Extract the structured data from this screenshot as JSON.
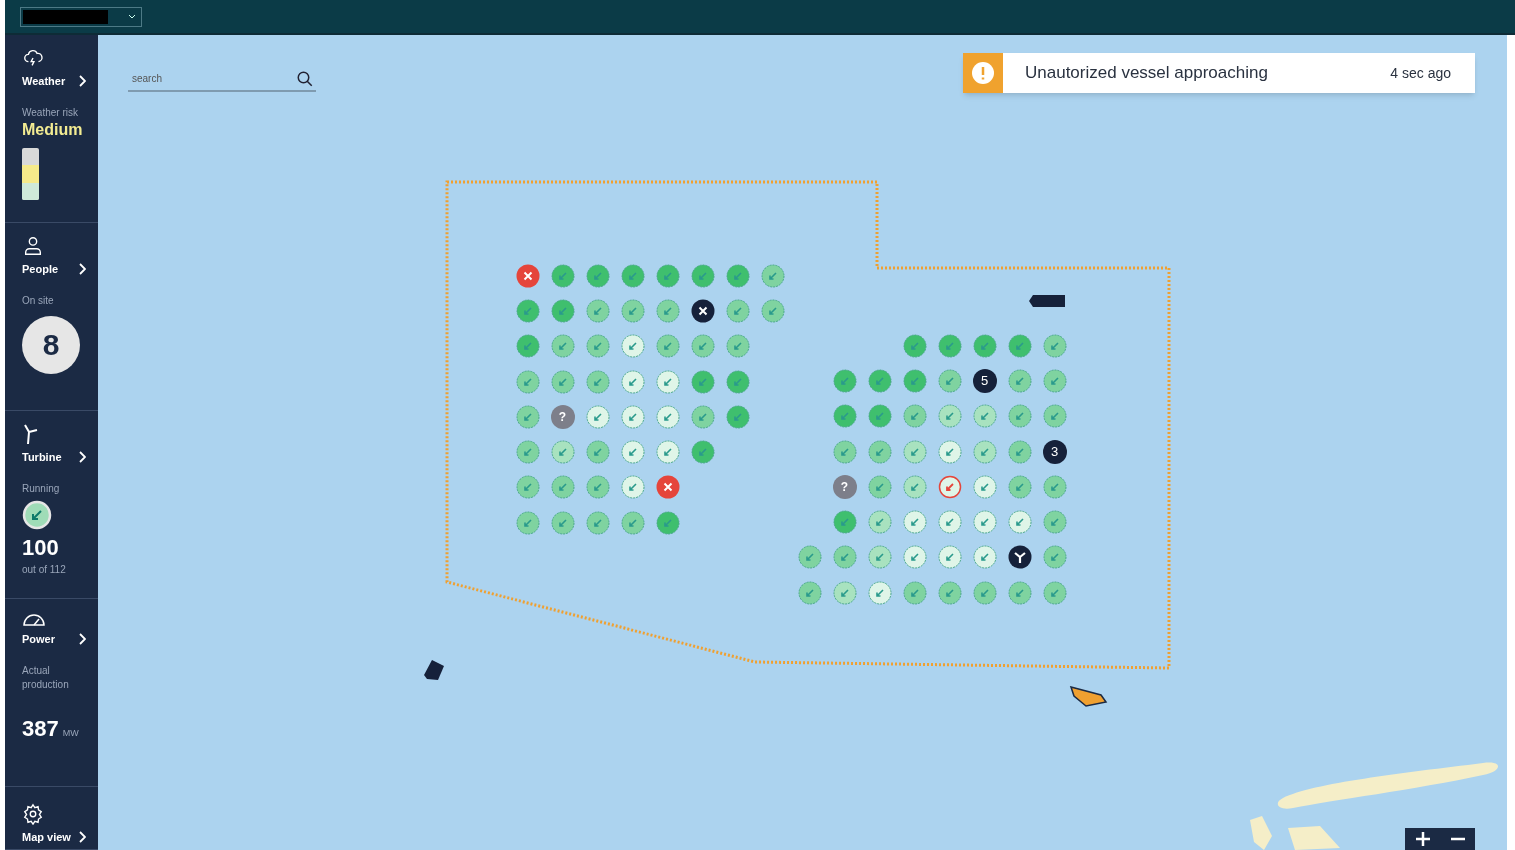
{
  "search": {
    "placeholder": "search"
  },
  "alert": {
    "message": "Unautorized vessel approaching",
    "time": "4 sec ago"
  },
  "sidebar": {
    "sections": [
      {
        "kind": "weather",
        "title": "Weather",
        "label": "Weather risk",
        "value": "Medium",
        "level": 0.67
      },
      {
        "kind": "people",
        "title": "People",
        "label": "On site",
        "value": "8"
      },
      {
        "kind": "turbine",
        "title": "Turbine",
        "label": "Running",
        "value": "100",
        "note": "out of 112"
      },
      {
        "kind": "power",
        "title": "Power",
        "label": "Actual production",
        "value": "387",
        "unit": "MW"
      },
      {
        "kind": "settings",
        "title": "Map view"
      }
    ]
  },
  "clusters": [
    {
      "rows": [
        [
          {
            "kind": "fault"
          },
          {
            "kind": "running",
            "color": "#3fbf6e"
          },
          {
            "kind": "running",
            "color": "#3fbf6e"
          },
          {
            "kind": "running",
            "color": "#3fbf6e"
          },
          {
            "kind": "running",
            "color": "#3fbf6e"
          },
          {
            "kind": "running",
            "color": "#3fbf6e"
          },
          {
            "kind": "running",
            "color": "#3fbf6e"
          },
          {
            "kind": "running",
            "color": "#7fd3a0"
          }
        ],
        [
          {
            "kind": "running",
            "color": "#3fbf6e"
          },
          {
            "kind": "running",
            "color": "#3fbf6e"
          },
          {
            "kind": "running",
            "color": "#7fd3a0"
          },
          {
            "kind": "running",
            "color": "#7fd3a0"
          },
          {
            "kind": "running",
            "color": "#7fd3a0"
          },
          {
            "kind": "stopped"
          },
          {
            "kind": "running",
            "color": "#7fd3a0"
          },
          {
            "kind": "running",
            "color": "#7fd3a0"
          }
        ],
        [
          {
            "kind": "running",
            "color": "#3fbf6e"
          },
          {
            "kind": "running",
            "color": "#7fd3a0"
          },
          {
            "kind": "running",
            "color": "#7fd3a0"
          },
          {
            "kind": "running",
            "color": "#dff5e8"
          },
          {
            "kind": "running",
            "color": "#7fd3a0"
          },
          {
            "kind": "running",
            "color": "#7fd3a0"
          },
          {
            "kind": "running",
            "color": "#7fd3a0"
          }
        ],
        [
          {
            "kind": "running",
            "color": "#7fd3a0"
          },
          {
            "kind": "running",
            "color": "#7fd3a0"
          },
          {
            "kind": "running",
            "color": "#7fd3a0"
          },
          {
            "kind": "running",
            "color": "#dff5e8"
          },
          {
            "kind": "running",
            "color": "#dff5e8"
          },
          {
            "kind": "running",
            "color": "#3fbf6e"
          },
          {
            "kind": "running",
            "color": "#3fbf6e"
          }
        ],
        [
          {
            "kind": "running",
            "color": "#7fd3a0"
          },
          {
            "kind": "unknown",
            "label": "?"
          },
          {
            "kind": "running",
            "color": "#dff5e8"
          },
          {
            "kind": "running",
            "color": "#dff5e8"
          },
          {
            "kind": "running",
            "color": "#dff5e8"
          },
          {
            "kind": "running",
            "color": "#7fd3a0"
          },
          {
            "kind": "running",
            "color": "#3fbf6e"
          }
        ],
        [
          {
            "kind": "running",
            "color": "#7fd3a0"
          },
          {
            "kind": "running",
            "color": "#a8e2bf"
          },
          {
            "kind": "running",
            "color": "#7fd3a0"
          },
          {
            "kind": "running",
            "color": "#dff5e8"
          },
          {
            "kind": "running",
            "color": "#dff5e8"
          },
          {
            "kind": "running",
            "color": "#3fbf6e"
          }
        ],
        [
          {
            "kind": "running",
            "color": "#7fd3a0"
          },
          {
            "kind": "running",
            "color": "#7fd3a0"
          },
          {
            "kind": "running",
            "color": "#7fd3a0"
          },
          {
            "kind": "running",
            "color": "#dff5e8"
          },
          {
            "kind": "fault"
          }
        ],
        [
          {
            "kind": "running",
            "color": "#7fd3a0"
          },
          {
            "kind": "running",
            "color": "#7fd3a0"
          },
          {
            "kind": "running",
            "color": "#7fd3a0"
          },
          {
            "kind": "running",
            "color": "#7fd3a0"
          },
          {
            "kind": "running",
            "color": "#3fbf6e"
          }
        ]
      ]
    },
    {
      "rows": [
        [
          {
            "kind": "empty"
          },
          {
            "kind": "empty"
          },
          {
            "kind": "empty"
          },
          {
            "kind": "running",
            "color": "#3fbf6e"
          },
          {
            "kind": "running",
            "color": "#3fbf6e"
          },
          {
            "kind": "running",
            "color": "#3fbf6e"
          },
          {
            "kind": "running",
            "color": "#3fbf6e"
          },
          {
            "kind": "running",
            "color": "#7fd3a0"
          }
        ],
        [
          {
            "kind": "empty"
          },
          {
            "kind": "running",
            "color": "#3fbf6e"
          },
          {
            "kind": "running",
            "color": "#3fbf6e"
          },
          {
            "kind": "running",
            "color": "#3fbf6e"
          },
          {
            "kind": "running",
            "color": "#7fd3a0"
          },
          {
            "kind": "count",
            "label": "5"
          },
          {
            "kind": "running",
            "color": "#7fd3a0"
          },
          {
            "kind": "running",
            "color": "#7fd3a0"
          }
        ],
        [
          {
            "kind": "empty"
          },
          {
            "kind": "running",
            "color": "#3fbf6e"
          },
          {
            "kind": "running",
            "color": "#3fbf6e"
          },
          {
            "kind": "running",
            "color": "#7fd3a0"
          },
          {
            "kind": "running",
            "color": "#a8e2bf"
          },
          {
            "kind": "running",
            "color": "#a8e2bf"
          },
          {
            "kind": "running",
            "color": "#7fd3a0"
          },
          {
            "kind": "running",
            "color": "#7fd3a0"
          }
        ],
        [
          {
            "kind": "empty"
          },
          {
            "kind": "running",
            "color": "#7fd3a0"
          },
          {
            "kind": "running",
            "color": "#7fd3a0"
          },
          {
            "kind": "running",
            "color": "#a8e2bf"
          },
          {
            "kind": "running",
            "color": "#dff5e8"
          },
          {
            "kind": "running",
            "color": "#a8e2bf"
          },
          {
            "kind": "running",
            "color": "#7fd3a0"
          },
          {
            "kind": "count",
            "label": "3"
          }
        ],
        [
          {
            "kind": "empty"
          },
          {
            "kind": "unknown",
            "label": "?"
          },
          {
            "kind": "running",
            "color": "#7fd3a0"
          },
          {
            "kind": "running",
            "color": "#a8e2bf"
          },
          {
            "kind": "alert"
          },
          {
            "kind": "running",
            "color": "#dff5e8"
          },
          {
            "kind": "running",
            "color": "#7fd3a0"
          },
          {
            "kind": "running",
            "color": "#7fd3a0"
          }
        ],
        [
          {
            "kind": "empty"
          },
          {
            "kind": "running",
            "color": "#3fbf6e"
          },
          {
            "kind": "running",
            "color": "#a8e2bf"
          },
          {
            "kind": "running",
            "color": "#dff5e8"
          },
          {
            "kind": "running",
            "color": "#dff5e8"
          },
          {
            "kind": "running",
            "color": "#dff5e8"
          },
          {
            "kind": "running",
            "color": "#dff5e8"
          },
          {
            "kind": "running",
            "color": "#7fd3a0"
          }
        ],
        [
          {
            "kind": "running",
            "color": "#7fd3a0"
          },
          {
            "kind": "running",
            "color": "#7fd3a0"
          },
          {
            "kind": "running",
            "color": "#a8e2bf"
          },
          {
            "kind": "running",
            "color": "#dff5e8"
          },
          {
            "kind": "running",
            "color": "#dff5e8"
          },
          {
            "kind": "running",
            "color": "#dff5e8"
          },
          {
            "kind": "maintenance"
          },
          {
            "kind": "running",
            "color": "#7fd3a0"
          }
        ],
        [
          {
            "kind": "running",
            "color": "#7fd3a0"
          },
          {
            "kind": "running",
            "color": "#a8e2bf"
          },
          {
            "kind": "running",
            "color": "#dff5e8"
          },
          {
            "kind": "running",
            "color": "#7fd3a0"
          },
          {
            "kind": "running",
            "color": "#7fd3a0"
          },
          {
            "kind": "running",
            "color": "#7fd3a0"
          },
          {
            "kind": "running",
            "color": "#7fd3a0"
          },
          {
            "kind": "running",
            "color": "#7fd3a0"
          }
        ]
      ]
    }
  ]
}
